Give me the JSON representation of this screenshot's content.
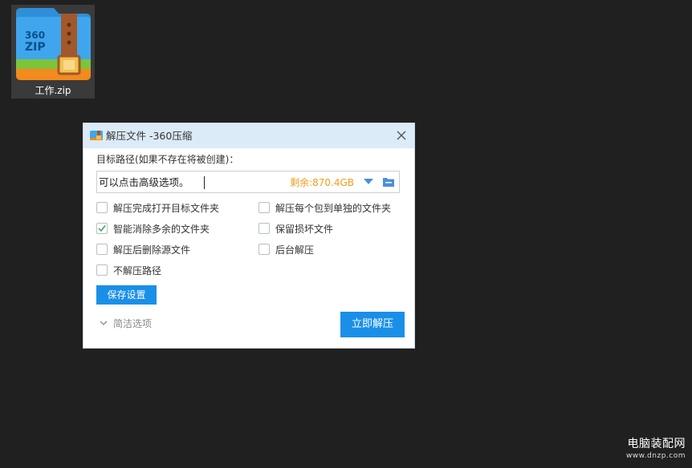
{
  "desktop_icon": {
    "filename": "工作.zip",
    "icon": "360zip-archive-icon",
    "art_text": "360\nZIP"
  },
  "dialog": {
    "title": "解压文件 -360压缩",
    "path_label": "目标路径(如果不存在将被创建)：",
    "path_value": "可以点击高级选项。",
    "free_space": "剩余:870.4GB",
    "options": [
      {
        "label": "解压完成打开目标文件夹",
        "checked": false
      },
      {
        "label": "解压每个包到单独的文件夹",
        "checked": false
      },
      {
        "label": "智能消除多余的文件夹",
        "checked": true
      },
      {
        "label": "保留损坏文件",
        "checked": false
      },
      {
        "label": "解压后删除源文件",
        "checked": false
      },
      {
        "label": "后台解压",
        "checked": false
      },
      {
        "label": "不解压路径",
        "checked": false
      }
    ],
    "save_button": "保存设置",
    "simple_options": "简洁选项",
    "extract_button": "立即解压"
  },
  "watermark": {
    "title": "电脑装配网",
    "url": "www.dnzp.com"
  },
  "colors": {
    "accent": "#1a8fe8",
    "free_space": "#f39b1c",
    "titlebar": "#dcebf8",
    "desktop": "#202020"
  }
}
